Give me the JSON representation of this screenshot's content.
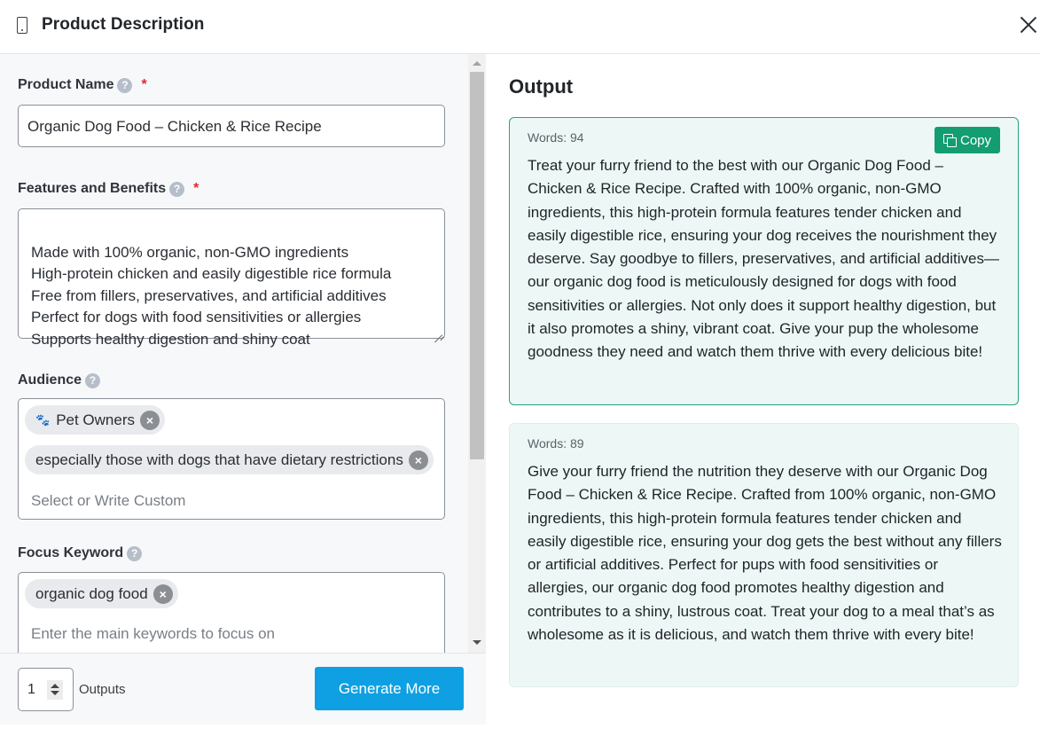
{
  "header": {
    "icon": "mobile-phone-icon",
    "title": "Product Description",
    "close_icon": "close-icon"
  },
  "form": {
    "product_name": {
      "label": "Product Name",
      "required": "*",
      "value": "Organic Dog Food – Chicken & Rice Recipe"
    },
    "features": {
      "label": "Features and Benefits",
      "required": "*",
      "value": "Made with 100% organic, non-GMO ingredients\nHigh-protein chicken and easily digestible rice formula\nFree from fillers, preservatives, and artificial additives\nPerfect for dogs with food sensitivities or allergies\nSupports healthy digestion and shiny coat"
    },
    "audience": {
      "label": "Audience",
      "tags": [
        {
          "icon": "paw-icon",
          "label": "Pet Owners"
        },
        {
          "label": "especially those with dogs that have dietary restrictions"
        }
      ],
      "placeholder": "Select or Write Custom"
    },
    "focus_keyword": {
      "label": "Focus Keyword",
      "tags": [
        {
          "label": "organic dog food"
        }
      ],
      "placeholder": "Enter the main keywords to focus on"
    },
    "help_glyph": "?"
  },
  "footer": {
    "outputs_value": "1",
    "outputs_label": "Outputs",
    "generate_label": "Generate More"
  },
  "output": {
    "title": "Output",
    "copy_label": "Copy",
    "results": [
      {
        "words": "Words: 94",
        "text": "Treat your furry friend to the best with our Organic Dog Food – Chicken & Rice Recipe. Crafted with 100% organic, non-GMO ingredients, this high-protein formula features tender chicken and easily digestible rice, ensuring your dog receives the nourishment they deserve. Say goodbye to fillers, preservatives, and artificial additives—our organic dog food is meticulously designed for dogs with food sensitivities or allergies. Not only does it support healthy digestion, but it also promotes a shiny, vibrant coat. Give your pup the wholesome goodness they need and watch them thrive with every delicious bite!"
      },
      {
        "words": "Words: 89",
        "text": "Give your furry friend the nutrition they deserve with our Organic Dog Food – Chicken & Rice Recipe. Crafted from 100% organic, non-GMO ingredients, this high-protein formula features tender chicken and easily digestible rice, ensuring your dog gets the best without any fillers or artificial additives. Perfect for pups with food sensitivities or allergies, our organic dog food promotes healthy digestion and contributes to a shiny, lustrous coat. Treat your dog to a meal that’s as wholesome as it is delicious, and watch them thrive with every bite!"
      }
    ]
  },
  "colors": {
    "primary_button": "#0ea0e2",
    "copy_button": "#139d70",
    "active_card_border": "#23a37f",
    "card_background": "#edf8f6",
    "required": "#e5252a"
  }
}
